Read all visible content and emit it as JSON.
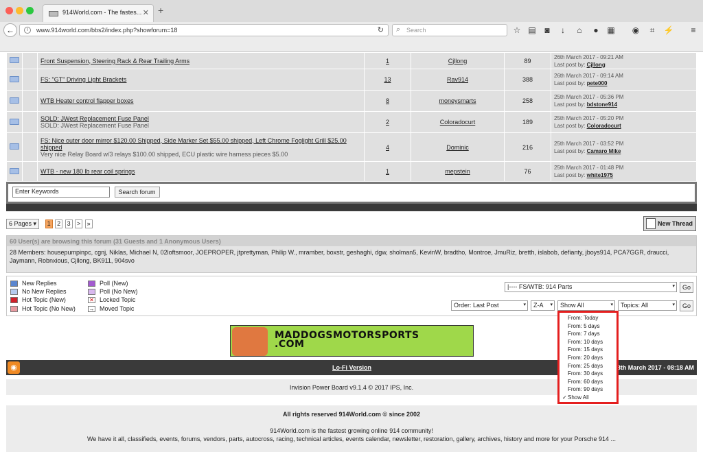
{
  "browser": {
    "tab_title": "914World.com - The fastes...",
    "url": "www.914world.com/bbs2/index.php?showforum=18",
    "search_placeholder": "Search"
  },
  "topics": [
    {
      "title": "FS: Front Suspension, Steering Rack & Rear Trailing Arms",
      "display": "Front Suspension, Steering Rack & Rear Trailing Arms",
      "subtitle": "",
      "replies": "1",
      "author": "Cjllong",
      "views": "89",
      "last_date": "26th March 2017 - 09:21 AM",
      "last_by_label": "Last post by:",
      "last_by": "Cjllong"
    },
    {
      "title": "FS: \"GT\" Driving Light Brackets",
      "display": "FS: \"GT\" Driving Light Brackets",
      "subtitle": "",
      "replies": "13",
      "author": "Rav914",
      "views": "388",
      "last_date": "26th March 2017 - 09:14 AM",
      "last_by_label": "Last post by:",
      "last_by": "pete000"
    },
    {
      "title": "WTB Heater control flapper boxes",
      "display": "WTB Heater control flapper boxes",
      "subtitle": "",
      "replies": "8",
      "author": "moneysmarts",
      "views": "258",
      "last_date": "25th March 2017 - 05:36 PM",
      "last_by_label": "Last post by:",
      "last_by": "bdstone914"
    },
    {
      "title": "SOLD: JWest Replacement Fuse Panel",
      "display": "SOLD: JWest Replacement Fuse Panel",
      "subtitle": "SOLD: JWest Replacement Fuse Panel",
      "replies": "2",
      "author": "Coloradocurt",
      "views": "189",
      "last_date": "25th March 2017 - 05:20 PM",
      "last_by_label": "Last post by:",
      "last_by": "Coloradocurt"
    },
    {
      "title": "FS: Nice outer door mirror",
      "display": "FS: Nice outer door mirror $120.00 Shipped, Side Marker Set $55.00 shipped, Left Chrome Foglight Grill $25.00 shipped",
      "subtitle": "Very nice Relay Board w/3 relays $100.00 shipped, ECU plastic wire harness pieces $5.00",
      "replies": "4",
      "author": "Dominic",
      "views": "216",
      "last_date": "25th March 2017 - 03:52 PM",
      "last_by_label": "Last post by:",
      "last_by": "Camaro Mike"
    },
    {
      "title": "WTB - new 180 lb rear coil springs",
      "display": "WTB - new 180 lb rear coil springs",
      "subtitle": "",
      "replies": "1",
      "author": "mepstein",
      "views": "76",
      "last_date": "25th March 2017 - 01:48 PM",
      "last_by_label": "Last post by:",
      "last_by": "white1975"
    }
  ],
  "search": {
    "keywords_value": "Enter Keywords",
    "button": "Search forum"
  },
  "pagination": {
    "pages_label": "6 Pages",
    "pages": [
      "1",
      "2",
      "3",
      ">",
      "»"
    ],
    "new_thread": "New Thread"
  },
  "users": {
    "heading": "60 User(s) are browsing this forum (31 Guests and 1 Anonymous Users)",
    "members": "28 Members: housepumpinpc, cgnj, Niklas, Michael N, 02loftsmoor, JOEPROPER, jtprettyman, Philip W., mramber, boxstr, geshaghi, dgw, sholman5, KevinW, bradtho, Montroe, JmuRiz, bretth, islabob, defianty, jboys914, PCA7GGR, draucci, Jaymann, Robnxious, Cjllong, BK911, 904svo"
  },
  "legend": [
    "New Replies",
    "No New Replies",
    "Hot Topic (New)",
    "Hot Topic (No New)",
    "Poll (New)",
    "Poll (No New)",
    "Locked Topic",
    "Moved Topic"
  ],
  "filters": {
    "forum_jump": "|---- FS/WTB: 914 Parts",
    "go": "Go",
    "order": "Order: Last Post",
    "direction": "Z-A",
    "show": "Show All",
    "topics": "Topics: All",
    "go2": "Go"
  },
  "dropdown_options": [
    "From: Today",
    "From: 5 days",
    "From: 7 days",
    "From: 10 days",
    "From: 15 days",
    "From: 20 days",
    "From: 25 days",
    "From: 30 days",
    "From: 60 days",
    "From: 90 days",
    "Show All"
  ],
  "banner": {
    "line1": "MADDOGSMOTORSPORTS",
    "line2": ".COM"
  },
  "footer": {
    "lofi": "Lo-Fi Version",
    "time": "28th March 2017 - 08:18 AM",
    "powered": "Invision Power Board v9.1.4 © 2017  IPS, Inc.",
    "rights": "All rights reserved 914World.com © since 2002",
    "tagline": "914World.com is the fastest growing online 914 community!",
    "about": "We have it all, classifieds, events, forums, vendors, parts, autocross, racing, technical articles, events calendar, newsletter, restoration, gallery, archives, history and more for your Porsche 914 ..."
  },
  "colors": {
    "accent_red": "#e41e1e",
    "bar_dark": "#3a3a3a",
    "row_bg": "#e0e0e0"
  }
}
